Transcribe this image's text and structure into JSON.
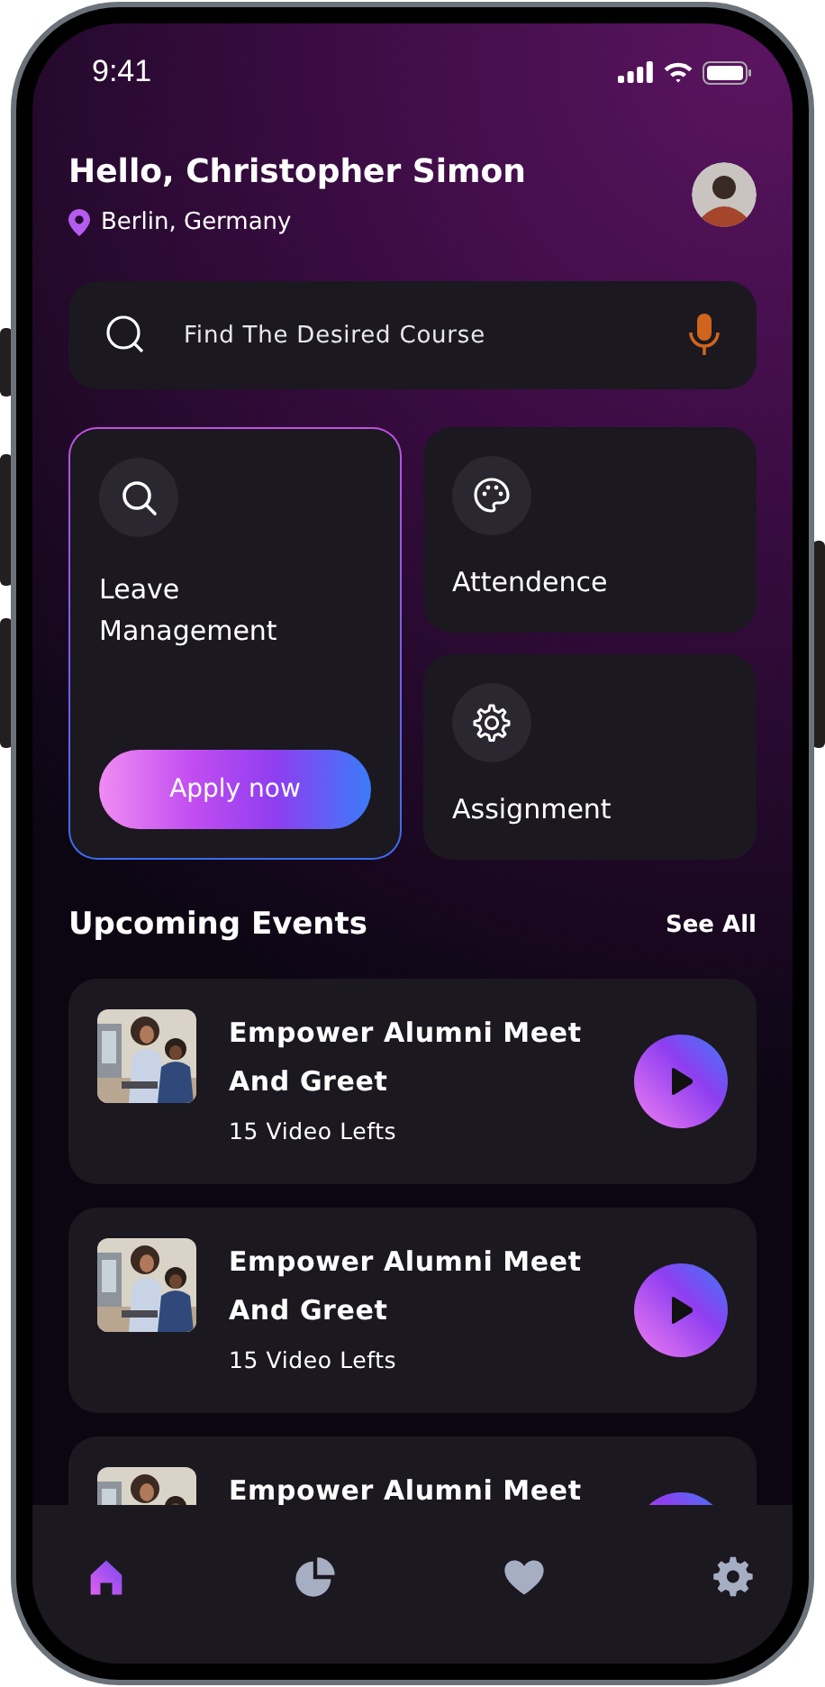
{
  "status_bar": {
    "time": "9:41"
  },
  "header": {
    "greeting": "Hello, Christopher Simon",
    "location": "Berlin, Germany"
  },
  "search": {
    "placeholder": "Find The Desired Course"
  },
  "tiles": [
    {
      "kind": "search",
      "label": "Leave Management",
      "highlighted": true,
      "button": "Apply now"
    },
    {
      "kind": "palette",
      "label": "Attendence",
      "highlighted": false
    },
    {
      "kind": "gear",
      "label": "Assignment",
      "highlighted": false
    }
  ],
  "section": {
    "title": "Upcoming Events",
    "action": "See All"
  },
  "events": [
    {
      "title": "Empower Alumni Meet And Greet",
      "subtitle": "15 Video Lefts"
    },
    {
      "title": "Empower Alumni Meet And Greet",
      "subtitle": "15 Video Lefts"
    },
    {
      "title": "Empower Alumni Meet"
    }
  ],
  "nav": [
    {
      "kind": "home",
      "selected": true
    },
    {
      "kind": "chart",
      "selected": false
    },
    {
      "kind": "heart",
      "selected": false
    },
    {
      "kind": "gear",
      "selected": false
    }
  ]
}
